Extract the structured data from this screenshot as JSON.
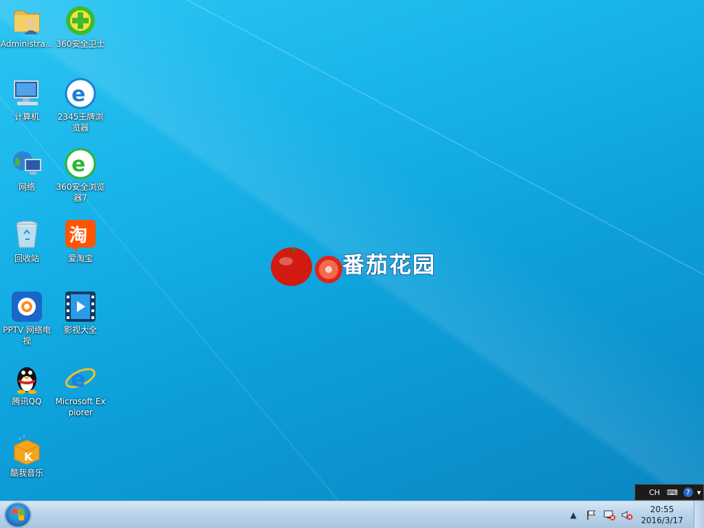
{
  "desktop": {
    "icons": [
      {
        "label": "Administra...",
        "icon": "folder-user-icon"
      },
      {
        "label": "360安全卫士",
        "icon": "360-guard-icon"
      },
      {
        "label": "计算机",
        "icon": "computer-icon"
      },
      {
        "label": "2345王牌浏览器",
        "icon": "2345-browser-icon"
      },
      {
        "label": "网络",
        "icon": "network-icon"
      },
      {
        "label": "360安全浏览器7",
        "icon": "360-browser-icon"
      },
      {
        "label": "回收站",
        "icon": "recycle-bin-icon"
      },
      {
        "label": "爱淘宝",
        "icon": "taobao-icon"
      },
      {
        "label": "PPTV 网络电视",
        "icon": "pptv-icon"
      },
      {
        "label": "影视大全",
        "icon": "video-player-icon"
      },
      {
        "label": "腾讯QQ",
        "icon": "qq-penguin-icon"
      },
      {
        "label": "Microsoft Expiorer",
        "icon": "internet-explorer-icon"
      },
      {
        "label": "酷我音乐",
        "icon": "kuwo-music-icon"
      }
    ],
    "brand_text": "番茄花园"
  },
  "langbar": {
    "lang": "CH"
  },
  "taskbar": {
    "clock_time": "20:55",
    "clock_date": "2016/3/17"
  },
  "colors": {
    "desktop_bg": "#19b4ea",
    "taskbar_bg": "#b9d3e9"
  }
}
